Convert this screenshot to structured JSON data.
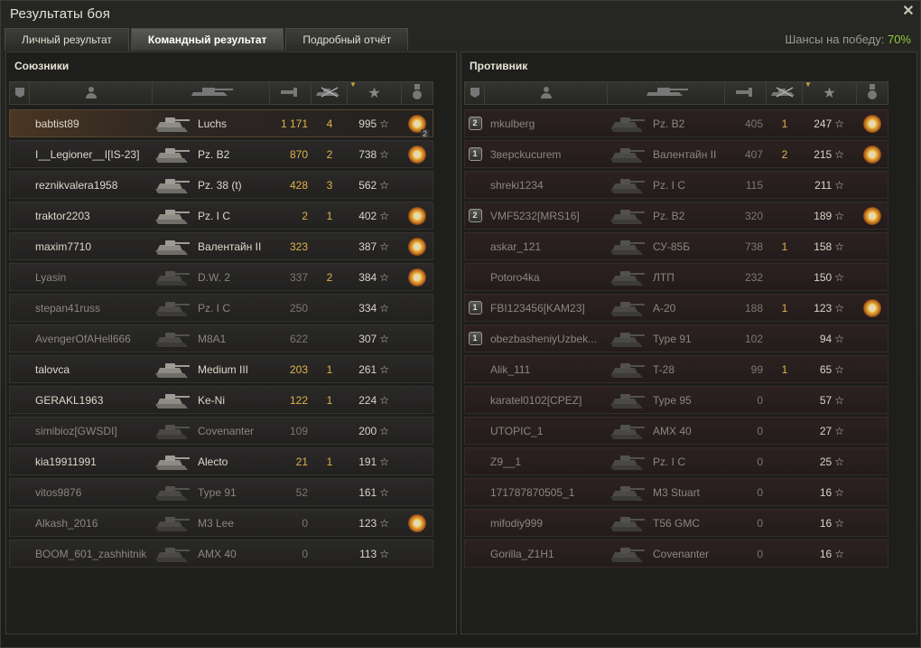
{
  "window": {
    "title": "Результаты боя"
  },
  "tabs": [
    {
      "label": "Личный результат",
      "active": false
    },
    {
      "label": "Командный результат",
      "active": true
    },
    {
      "label": "Подробный отчёт",
      "active": false
    }
  ],
  "win_chance": {
    "label": "Шансы на победу:",
    "value": "70%"
  },
  "column_icons": [
    "platoon-icon",
    "player-icon",
    "tank-icon",
    "damage-icon",
    "kills-icon",
    "experience-star-icon",
    "medal-icon"
  ],
  "colors": {
    "accent": "#8ecc3a",
    "damage": "#e2b24a",
    "medal": "#f2c24a"
  },
  "allies": {
    "title": "Союзники",
    "rows": [
      {
        "name": "babtist89",
        "tank": "Luchs",
        "damage": "1 171",
        "kills": "4",
        "xp": "995",
        "medal": true,
        "medal_count": "2",
        "platoon": "",
        "alive": true,
        "me": true
      },
      {
        "name": "I__Legioner__I[IS-23]",
        "tank": "Pz. B2",
        "damage": "870",
        "kills": "2",
        "xp": "738",
        "medal": true,
        "platoon": "",
        "alive": true
      },
      {
        "name": "reznikvalera1958",
        "tank": "Pz. 38 (t)",
        "damage": "428",
        "kills": "3",
        "xp": "562",
        "medal": false,
        "platoon": "",
        "alive": true
      },
      {
        "name": "traktor2203",
        "tank": "Pz. I C",
        "damage": "2",
        "kills": "1",
        "xp": "402",
        "medal": true,
        "platoon": "",
        "alive": true
      },
      {
        "name": "maxim7710",
        "tank": "Валентайн II",
        "damage": "323",
        "kills": "",
        "xp": "387",
        "medal": true,
        "platoon": "",
        "alive": true
      },
      {
        "name": "Lyasin",
        "tank": "D.W. 2",
        "damage": "337",
        "kills": "2",
        "xp": "384",
        "medal": true,
        "platoon": "",
        "alive": false
      },
      {
        "name": "stepan41russ",
        "tank": "Pz. I C",
        "damage": "250",
        "kills": "",
        "xp": "334",
        "medal": false,
        "platoon": "",
        "alive": false
      },
      {
        "name": "AvengerOfAHell666",
        "tank": "M8A1",
        "damage": "622",
        "kills": "",
        "xp": "307",
        "medal": false,
        "platoon": "",
        "alive": false
      },
      {
        "name": "talovca",
        "tank": "Medium III",
        "damage": "203",
        "kills": "1",
        "xp": "261",
        "medal": false,
        "platoon": "",
        "alive": true
      },
      {
        "name": "GERAKL1963",
        "tank": "Ke-Ni",
        "damage": "122",
        "kills": "1",
        "xp": "224",
        "medal": false,
        "platoon": "",
        "alive": true
      },
      {
        "name": "simibioz[GWSDI]",
        "tank": "Covenanter",
        "damage": "109",
        "kills": "",
        "xp": "200",
        "medal": false,
        "platoon": "",
        "alive": false
      },
      {
        "name": "kia19911991",
        "tank": "Alecto",
        "damage": "21",
        "kills": "1",
        "xp": "191",
        "medal": false,
        "platoon": "",
        "alive": true
      },
      {
        "name": "vitos9876",
        "tank": "Type 91",
        "damage": "52",
        "kills": "",
        "xp": "161",
        "medal": false,
        "platoon": "",
        "alive": false
      },
      {
        "name": "Alkash_2016",
        "tank": "M3 Lee",
        "damage": "0",
        "kills": "",
        "xp": "123",
        "medal": true,
        "platoon": "",
        "alive": false
      },
      {
        "name": "BOOM_601_zashhitnik",
        "tank": "AMX 40",
        "damage": "0",
        "kills": "",
        "xp": "113",
        "medal": false,
        "platoon": "",
        "alive": false
      }
    ]
  },
  "enemies": {
    "title": "Противник",
    "rows": [
      {
        "name": "mkulberg",
        "tank": "Pz. B2",
        "damage": "405",
        "kills": "1",
        "xp": "247",
        "medal": true,
        "platoon": "2",
        "alive": false
      },
      {
        "name": "3вepckucurem",
        "tank": "Валентайн II",
        "damage": "407",
        "kills": "2",
        "xp": "215",
        "medal": true,
        "platoon": "1",
        "alive": false
      },
      {
        "name": "shreki1234",
        "tank": "Pz. I C",
        "damage": "115",
        "kills": "",
        "xp": "211",
        "medal": false,
        "platoon": "",
        "alive": false
      },
      {
        "name": "VMF5232[MRS16]",
        "tank": "Pz. B2",
        "damage": "320",
        "kills": "",
        "xp": "189",
        "medal": true,
        "platoon": "2",
        "alive": false
      },
      {
        "name": "askar_121",
        "tank": "СУ-85Б",
        "damage": "738",
        "kills": "1",
        "xp": "158",
        "medal": false,
        "platoon": "",
        "alive": false
      },
      {
        "name": "Potoro4ka",
        "tank": "ЛТП",
        "damage": "232",
        "kills": "",
        "xp": "150",
        "medal": false,
        "platoon": "",
        "alive": false
      },
      {
        "name": "FBI123456[KAM23]",
        "tank": "A-20",
        "damage": "188",
        "kills": "1",
        "xp": "123",
        "medal": true,
        "platoon": "1",
        "alive": false
      },
      {
        "name": "obezbasheniyUzbek...",
        "tank": "Type 91",
        "damage": "102",
        "kills": "",
        "xp": "94",
        "medal": false,
        "platoon": "1",
        "alive": false
      },
      {
        "name": "Alik_111",
        "tank": "T-28",
        "damage": "99",
        "kills": "1",
        "xp": "65",
        "medal": false,
        "platoon": "",
        "alive": false
      },
      {
        "name": "karatel0102[CPEZ]",
        "tank": "Type 95",
        "damage": "0",
        "kills": "",
        "xp": "57",
        "medal": false,
        "platoon": "",
        "alive": false
      },
      {
        "name": "UTOPIC_1",
        "tank": "AMX 40",
        "damage": "0",
        "kills": "",
        "xp": "27",
        "medal": false,
        "platoon": "",
        "alive": false
      },
      {
        "name": "Z9__1",
        "tank": "Pz. I C",
        "damage": "0",
        "kills": "",
        "xp": "25",
        "medal": false,
        "platoon": "",
        "alive": false
      },
      {
        "name": "171787870505_1",
        "tank": "M3 Stuart",
        "damage": "0",
        "kills": "",
        "xp": "16",
        "medal": false,
        "platoon": "",
        "alive": false
      },
      {
        "name": "mifodiy999",
        "tank": "T56 GMC",
        "damage": "0",
        "kills": "",
        "xp": "16",
        "medal": false,
        "platoon": "",
        "alive": false
      },
      {
        "name": "Gorilla_Z1H1",
        "tank": "Covenanter",
        "damage": "0",
        "kills": "",
        "xp": "16",
        "medal": false,
        "platoon": "",
        "alive": false
      }
    ]
  }
}
